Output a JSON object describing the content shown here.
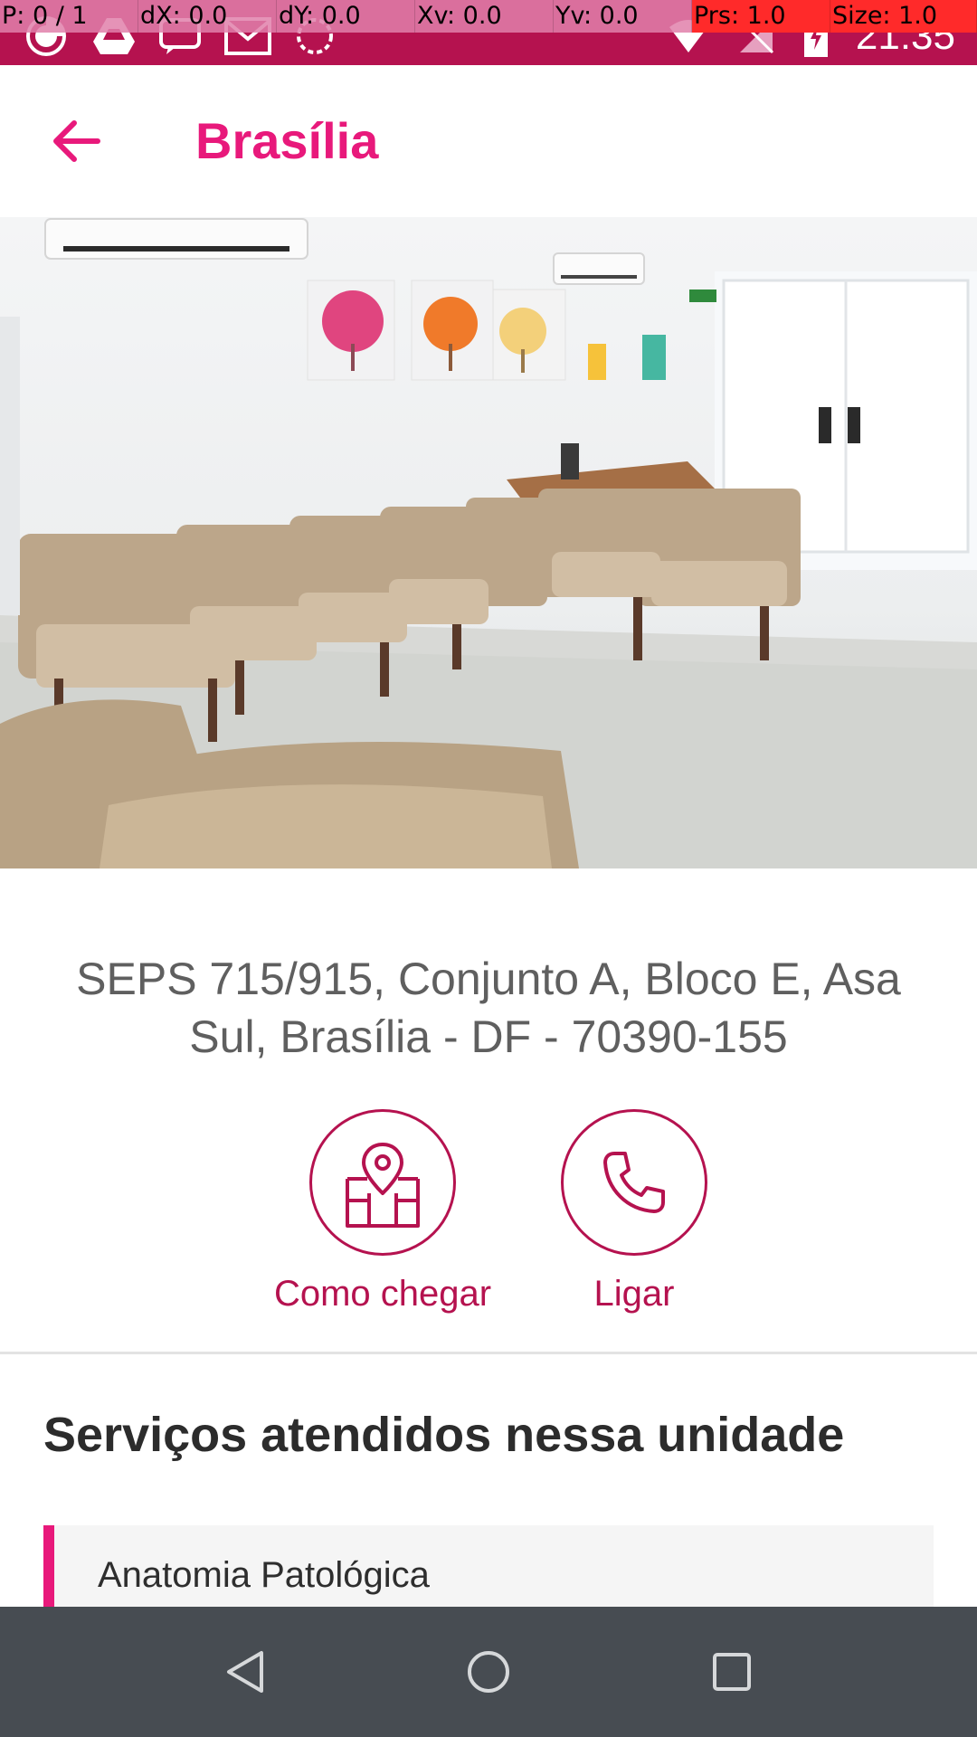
{
  "pointer_overlay": [
    {
      "text": "P: 0 / 1",
      "alert": false
    },
    {
      "text": "dX: 0.0",
      "alert": false
    },
    {
      "text": "dY: 0.0",
      "alert": false
    },
    {
      "text": "Xv: 0.0",
      "alert": false
    },
    {
      "text": "Yv: 0.0",
      "alert": false
    },
    {
      "text": "Prs: 1.0",
      "alert": true
    },
    {
      "text": "Size: 1.0",
      "alert": true
    }
  ],
  "status_bar": {
    "time": "21:35",
    "left_icons": [
      "sync-icon",
      "drive-icon",
      "message-icon",
      "gmail-icon",
      "loading-icon"
    ],
    "right_icons": [
      "wifi-icon",
      "no-signal-icon",
      "battery-charging-icon"
    ]
  },
  "app_bar": {
    "title": "Brasília",
    "back_icon": "arrow-back-icon"
  },
  "unit": {
    "address": "SEPS 715/915, Conjunto A, Bloco E, Asa Sul, Brasília - DF - 70390-155",
    "actions": [
      {
        "label": "Como chegar",
        "icon": "map-pin-icon"
      },
      {
        "label": "Ligar",
        "icon": "phone-icon"
      }
    ]
  },
  "services": {
    "title": "Serviços atendidos nessa unidade",
    "items": [
      "Anatomia Patológica"
    ]
  },
  "nav_bar": {
    "buttons": [
      "back-triangle-icon",
      "home-circle-icon",
      "recents-square-icon"
    ]
  },
  "colors": {
    "primary": "#e8197b",
    "primary_dark": "#b5124f",
    "nav_bar": "#474c52"
  }
}
